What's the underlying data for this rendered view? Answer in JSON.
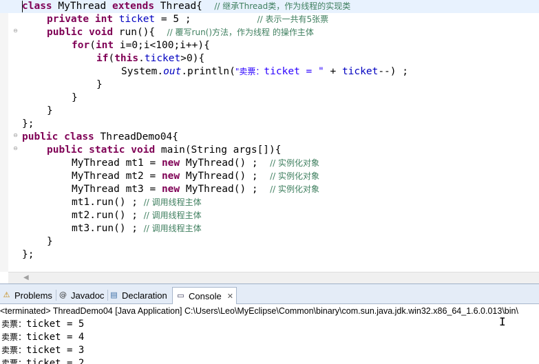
{
  "editor": {
    "lines": {
      "l1": {
        "kw1": "class",
        "t1": " MyThread ",
        "kw2": "extends",
        "t2": " Thread{  ",
        "cm": "// 继承Thread类，作为线程的实现类"
      },
      "l2": {
        "kw1": "private",
        "t1": " ",
        "kw2": "int",
        "t2": " ",
        "fld": "ticket",
        "t3": " = 5 ;           ",
        "cm": "// 表示一共有5张票"
      },
      "l3": {
        "kw1": "public",
        "t1": " ",
        "kw2": "void",
        "t2": " run(){  ",
        "cm": "// 覆写run()方法，作为线程 的操作主体"
      },
      "l4": {
        "kw1": "for",
        "t1": "(",
        "kw2": "int",
        "t2": " i=0;i<100;i++){"
      },
      "l5": {
        "kw1": "if",
        "t1": "(",
        "kw2": "this",
        "t2": ".",
        "fld": "ticket",
        "t3": ">0){"
      },
      "l6": {
        "t1": "System.",
        "ital": "out",
        "t2": ".println(",
        "str1": "\"卖票：",
        "str2": "ticket = \"",
        "t3": " + ",
        "fld": "ticket",
        "t4": "--) ;"
      },
      "l7": {
        "t1": "}"
      },
      "l8": {
        "t1": "}"
      },
      "l9": {
        "t1": "}"
      },
      "l10": {
        "t1": "};"
      },
      "l11": {
        "kw1": "public",
        "t1": " ",
        "kw2": "class",
        "t2": " ThreadDemo04{"
      },
      "l12": {
        "kw1": "public",
        "t1": " ",
        "kw2": "static",
        "t2": " ",
        "kw3": "void",
        "t3": " main(String args[]){"
      },
      "l13": {
        "t1": "MyThread mt1 = ",
        "kw1": "new",
        "t2": " MyThread() ;  ",
        "cm": "// 实例化对象"
      },
      "l14": {
        "t1": "MyThread mt2 = ",
        "kw1": "new",
        "t2": " MyThread() ;  ",
        "cm": "// 实例化对象"
      },
      "l15": {
        "t1": "MyThread mt3 = ",
        "kw1": "new",
        "t2": " MyThread() ;  ",
        "cm": "// 实例化对象"
      },
      "l16": {
        "t1": "mt1.run() ; ",
        "cm": "// 调用线程主体"
      },
      "l17": {
        "t1": "mt2.run() ; ",
        "cm": "// 调用线程主体"
      },
      "l18": {
        "t1": "mt3.run() ; ",
        "cm": "// 调用线程主体"
      },
      "l19": {
        "t1": "}"
      },
      "l20": {
        "t1": "};"
      }
    },
    "fold_glyph": "⊖",
    "scroll_left_glyph": "◀"
  },
  "panel": {
    "tabs": {
      "problems": {
        "label": "Problems",
        "icon": "problems-icon",
        "glyph": "⚠"
      },
      "javadoc": {
        "label": "Javadoc",
        "icon": "javadoc-icon",
        "glyph": "@"
      },
      "declaration": {
        "label": "Declaration",
        "icon": "declaration-icon",
        "glyph": "▤"
      },
      "console": {
        "label": "Console",
        "icon": "console-icon",
        "glyph": "▭",
        "close_glyph": "✕"
      }
    },
    "terminated": "<terminated> ThreadDemo04 [Java Application] C:\\Users\\Leo\\MyEclipse\\Common\\binary\\com.sun.java.jdk.win32.x86_64_1.6.0.013\\bin\\",
    "output": {
      "o1": {
        "cn": "卖票：",
        "t": "ticket = 5"
      },
      "o2": {
        "cn": "卖票：",
        "t": "ticket = 4"
      },
      "o3": {
        "cn": "卖票：",
        "t": "ticket = 3"
      },
      "o4": {
        "cn": "卖票：",
        "t": "ticket = 2"
      }
    }
  },
  "colors": {
    "keyword": "#7f0055",
    "field": "#0000c0",
    "comment": "#3f7f5f",
    "string": "#2a00ff"
  },
  "cursor_glyph": "I"
}
